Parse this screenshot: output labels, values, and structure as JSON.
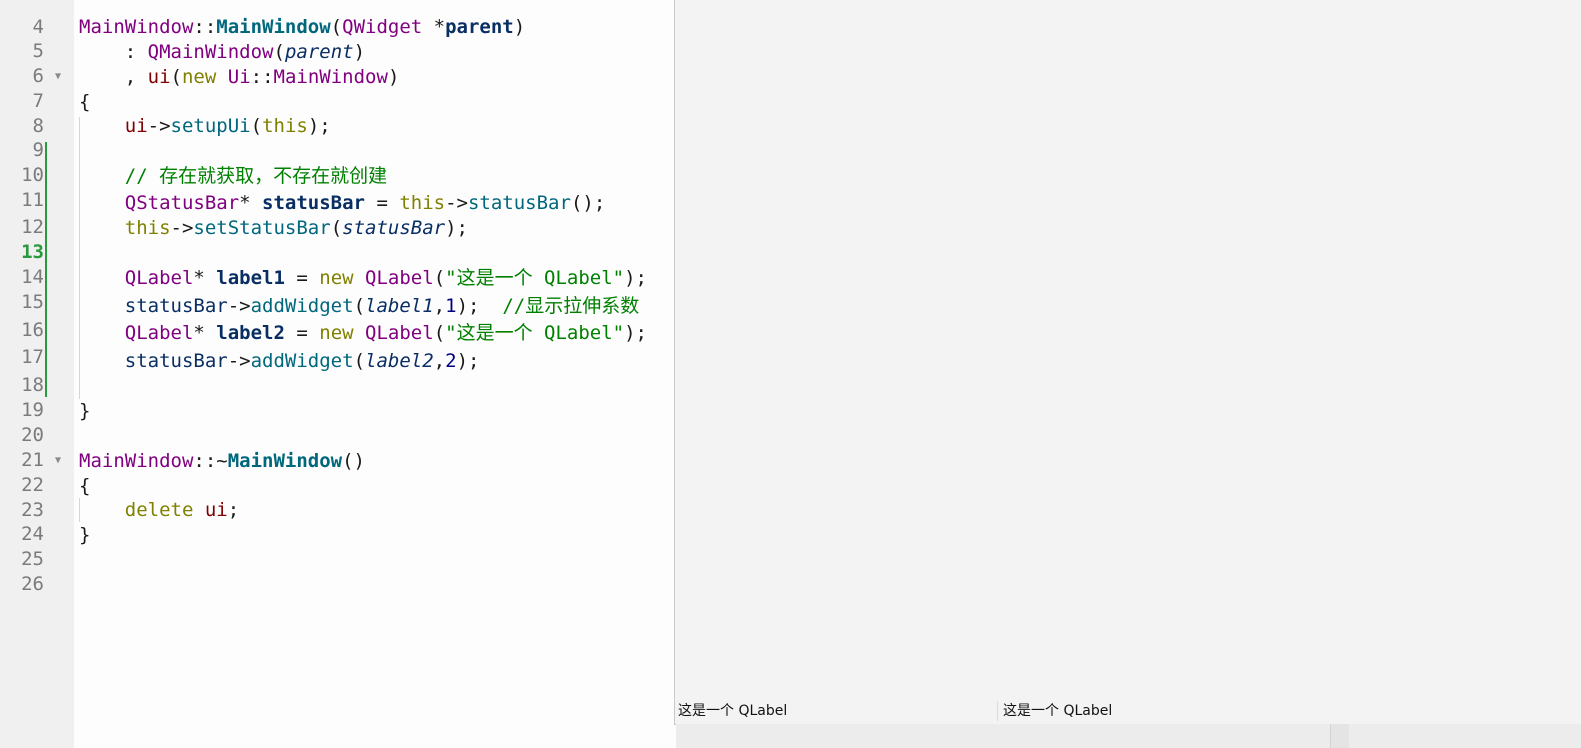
{
  "editor": {
    "current_line": "13",
    "lines": [
      {
        "n": "4",
        "text": ""
      },
      {
        "n": "5",
        "text": "MainWindow::MainWindow(QWidget *parent)"
      },
      {
        "n": "6",
        "text": "    : QMainWindow(parent)"
      },
      {
        "n": "7",
        "text": "    , ui(new Ui::MainWindow)"
      },
      {
        "n": "8",
        "text": "{"
      },
      {
        "n": "9",
        "text": "    ui->setupUi(this);"
      },
      {
        "n": "10",
        "text": ""
      },
      {
        "n": "11",
        "text": "    // 存在就获取，不存在就创建"
      },
      {
        "n": "12",
        "text": "    QStatusBar* statusBar = this->statusBar();"
      },
      {
        "n": "13",
        "text": "    this->setStatusBar(statusBar);"
      },
      {
        "n": "14",
        "text": ""
      },
      {
        "n": "15",
        "text": "    QLabel* label1 = new QLabel(\"这是一个 QLabel\");"
      },
      {
        "n": "16",
        "text": "    statusBar->addWidget(label1,1);  //显示拉伸系数"
      },
      {
        "n": "17",
        "text": "    QLabel* label2 = new QLabel(\"这是一个 QLabel\");"
      },
      {
        "n": "18",
        "text": "    statusBar->addWidget(label2,2);"
      },
      {
        "n": "19",
        "text": ""
      },
      {
        "n": "20",
        "text": "}"
      },
      {
        "n": "21",
        "text": ""
      },
      {
        "n": "22",
        "text": "MainWindow::~MainWindow()"
      },
      {
        "n": "23",
        "text": "{"
      },
      {
        "n": "24",
        "text": "    delete ui;"
      },
      {
        "n": "25",
        "text": "}"
      },
      {
        "n": "26",
        "text": ""
      }
    ]
  },
  "app_window": {
    "status_labels": [
      "这是一个 QLabel",
      "这是一个 QLabel"
    ]
  },
  "colors": {
    "keyword": "#808000",
    "class": "#800080",
    "function": "#00677c",
    "string": "#008000",
    "comment": "#008000",
    "change_marker": "#2b9a3f"
  }
}
